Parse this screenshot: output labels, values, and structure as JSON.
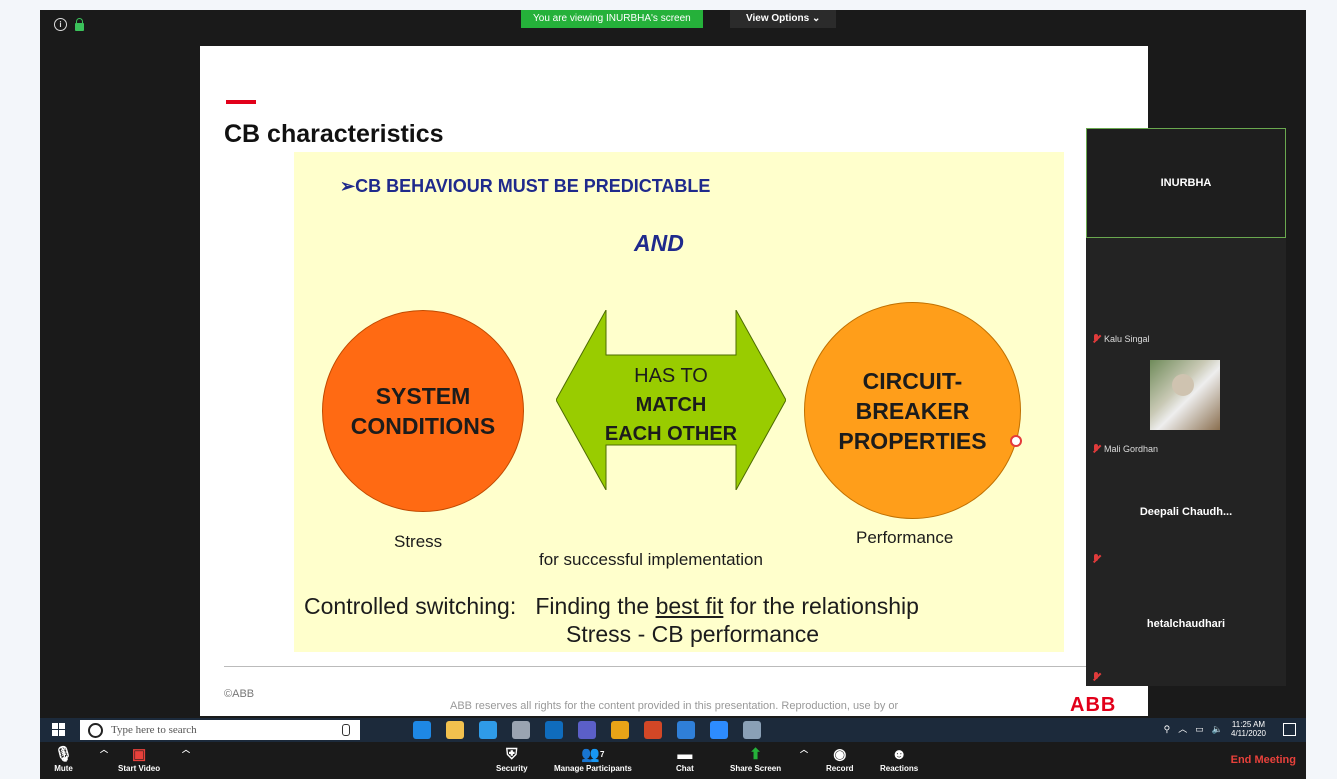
{
  "zoom": {
    "banner_text": "You are viewing INURBHA's screen",
    "view_options_label": "View Options ⌄",
    "info_icon": "i"
  },
  "slide": {
    "title": "CB characteristics",
    "bullet": "➢CB BEHAVIOUR MUST BE PREDICTABLE",
    "and_text": "AND",
    "left_circle": [
      "SYSTEM",
      "CONDITIONS"
    ],
    "right_circle": [
      "CIRCUIT-",
      "BREAKER",
      "PROPERTIES"
    ],
    "arrow_text": [
      "HAS TO",
      "MATCH",
      "EACH OTHER"
    ],
    "stress_label": "Stress",
    "performance_label": "Performance",
    "implementation_label": "for successful implementation",
    "controlled_prefix": "Controlled switching:   Finding the ",
    "controlled_best": "best fit",
    "controlled_suffix": " for the relationship",
    "controlled_line2": "Stress - CB performance",
    "copyright": "©ABB",
    "reserves": "ABB reserves all rights for the content provided in this presentation. Reproduction, use by or",
    "logo": "ABB"
  },
  "participants": [
    {
      "name": "INURBHA",
      "active": true
    },
    {
      "name": "Kalu Singal"
    },
    {
      "name": "Mali Gordhan"
    },
    {
      "name": "Deepali  Chaudh..."
    },
    {
      "name": "hetalchaudhari"
    }
  ],
  "taskbar": {
    "search_placeholder": "Type here to search",
    "time": "11:25 AM",
    "date": "4/11/2020",
    "apps": [
      {
        "name": "task-view",
        "color": "#1c2a3b"
      },
      {
        "name": "edge",
        "color": "#1e88e5"
      },
      {
        "name": "file-explorer",
        "color": "#f2c14e"
      },
      {
        "name": "internet-explorer",
        "color": "#2f9be8"
      },
      {
        "name": "app-paint",
        "color": "#9aa4b1"
      },
      {
        "name": "outlook",
        "color": "#0f6cbd"
      },
      {
        "name": "teams",
        "color": "#5b5fc7"
      },
      {
        "name": "chrome",
        "color": "#e8a317"
      },
      {
        "name": "powerpoint",
        "color": "#d24726"
      },
      {
        "name": "app-blue",
        "color": "#2f7fd8"
      },
      {
        "name": "zoom",
        "color": "#2d8cff"
      },
      {
        "name": "app-misc",
        "color": "#8aa0b6"
      }
    ]
  },
  "controls": {
    "mute": "Mute",
    "start_video": "Start Video",
    "security": "Security",
    "manage_participants": "Manage Participants",
    "participant_count": "7",
    "chat": "Chat",
    "share_screen": "Share Screen",
    "record": "Record",
    "reactions": "Reactions",
    "end_meeting": "End Meeting"
  },
  "colors": {
    "banner_green": "#25b13a",
    "slide_yellow": "#ffffcc",
    "left_circle": "#ff6a13",
    "right_circle": "#ff9e1a",
    "arrow_green": "#99cc00",
    "end_meeting": "#e8413b"
  }
}
